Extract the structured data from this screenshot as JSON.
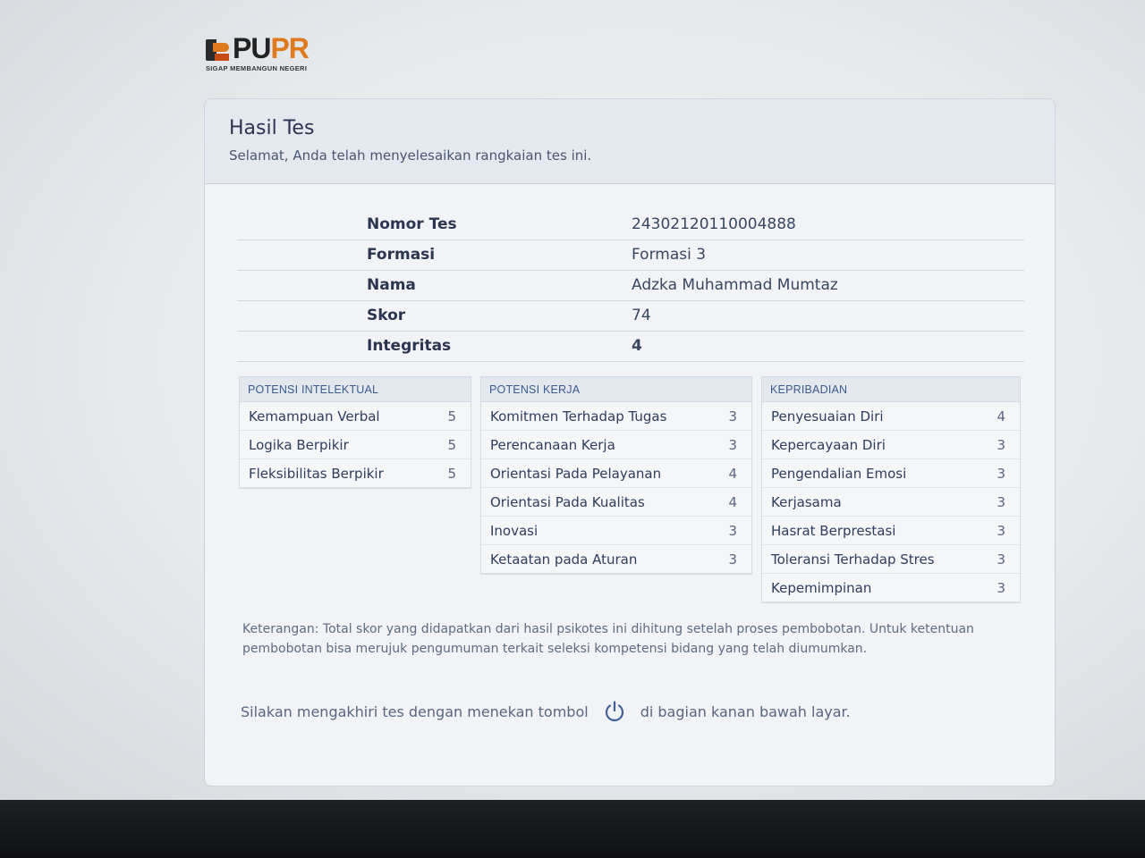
{
  "logo": {
    "text_a": "PU",
    "text_b": "PR",
    "tagline": "SIGAP MEMBANGUN NEGERI"
  },
  "header": {
    "title": "Hasil Tes",
    "subtitle": "Selamat, Anda telah menyelesaikan rangkaian tes ini."
  },
  "info": [
    {
      "label": "Nomor Tes",
      "value": "24302120110004888"
    },
    {
      "label": "Formasi",
      "value": "Formasi 3"
    },
    {
      "label": "Nama",
      "value": "Adzka Muhammad Mumtaz"
    },
    {
      "label": "Skor",
      "value": "74"
    },
    {
      "label": "Integritas",
      "value": "4"
    }
  ],
  "panels": [
    {
      "title": "POTENSI INTELEKTUAL",
      "rows": [
        {
          "label": "Kemampuan Verbal",
          "value": "5"
        },
        {
          "label": "Logika Berpikir",
          "value": "5"
        },
        {
          "label": "Fleksibilitas Berpikir",
          "value": "5"
        }
      ]
    },
    {
      "title": "POTENSI KERJA",
      "rows": [
        {
          "label": "Komitmen Terhadap Tugas",
          "value": "3"
        },
        {
          "label": "Perencanaan Kerja",
          "value": "3"
        },
        {
          "label": "Orientasi Pada Pelayanan",
          "value": "4"
        },
        {
          "label": "Orientasi Pada Kualitas",
          "value": "4"
        },
        {
          "label": "Inovasi",
          "value": "3"
        },
        {
          "label": "Ketaatan pada Aturan",
          "value": "3"
        }
      ]
    },
    {
      "title": "KEPRIBADIAN",
      "rows": [
        {
          "label": "Penyesuaian Diri",
          "value": "4"
        },
        {
          "label": "Kepercayaan Diri",
          "value": "3"
        },
        {
          "label": "Pengendalian Emosi",
          "value": "3"
        },
        {
          "label": "Kerjasama",
          "value": "3"
        },
        {
          "label": "Hasrat Berprestasi",
          "value": "3"
        },
        {
          "label": "Toleransi Terhadap Stres",
          "value": "3"
        },
        {
          "label": "Kepemimpinan",
          "value": "3"
        }
      ]
    }
  ],
  "note": "Keterangan: Total skor yang didapatkan dari hasil psikotes ini dihitung setelah proses pembobotan. Untuk ketentuan pembobotan bisa merujuk pengumuman terkait seleksi kompetensi bidang yang telah diumumkan.",
  "bottom": {
    "before_icon": "Silakan mengakhiri tes dengan menekan tombol",
    "icon": "power-icon",
    "after_icon": "di bagian kanan bawah layar."
  }
}
